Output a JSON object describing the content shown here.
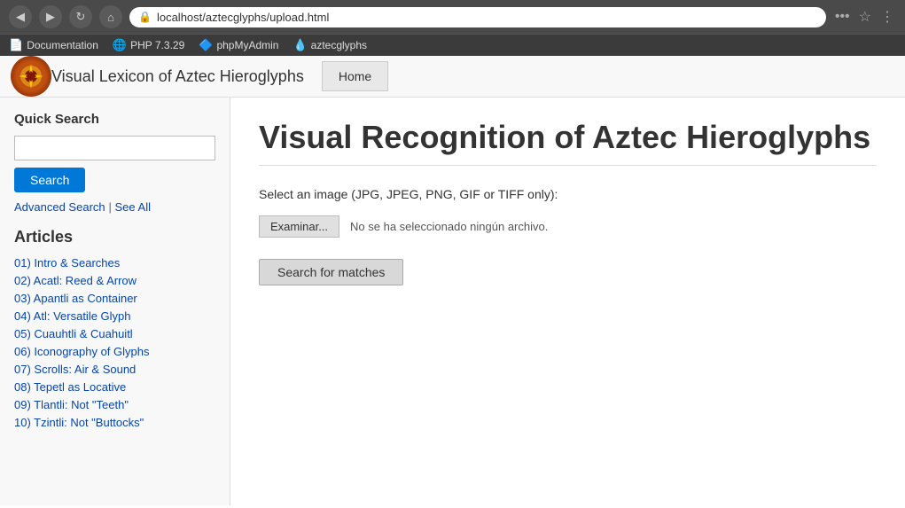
{
  "browser": {
    "back_btn": "◀",
    "forward_btn": "▶",
    "refresh_btn": "↻",
    "home_btn": "⌂",
    "address": "localhost/aztecglyphs/upload.html",
    "security_icon": "🔒",
    "more_btn": "•••",
    "bookmark_btn": "☆",
    "profile_btn": "⋮",
    "bookmarks": [
      {
        "icon": "📄",
        "label": "Documentation"
      },
      {
        "icon": "🌐",
        "label": "PHP 7.3.29"
      },
      {
        "icon": "🔷",
        "label": "phpMyAdmin"
      },
      {
        "icon": "💧",
        "label": "aztecglyphs"
      }
    ]
  },
  "header": {
    "logo_emoji": "🌀",
    "site_title": "Visual Lexicon of Aztec Hieroglyphs",
    "nav_home": "Home"
  },
  "sidebar": {
    "quick_search_label": "Quick Search",
    "search_placeholder": "",
    "search_btn": "Search",
    "advanced_search": "Advanced Search",
    "see_all": "See All",
    "articles_title": "Articles",
    "articles": [
      "01) Intro & Searches",
      "02) Acatl: Reed & Arrow",
      "03) Apantli as Container",
      "04) Atl: Versatile Glyph",
      "05) Cuauhtli & Cuahuitl",
      "06) Iconography of Glyphs",
      "07) Scrolls: Air & Sound",
      "08) Tepetl as Locative",
      "09) Tlantli: Not \"Teeth\"",
      "10) Tzintli: Not \"Buttocks\""
    ]
  },
  "content": {
    "heading": "Visual Recognition of Aztec Hieroglyphs",
    "select_label": "Select an image (JPG, JPEG, PNG, GIF or TIFF only):",
    "file_btn": "Examinar...",
    "file_status": "No se ha seleccionado ningún archivo.",
    "search_matches_btn": "Search for matches"
  }
}
